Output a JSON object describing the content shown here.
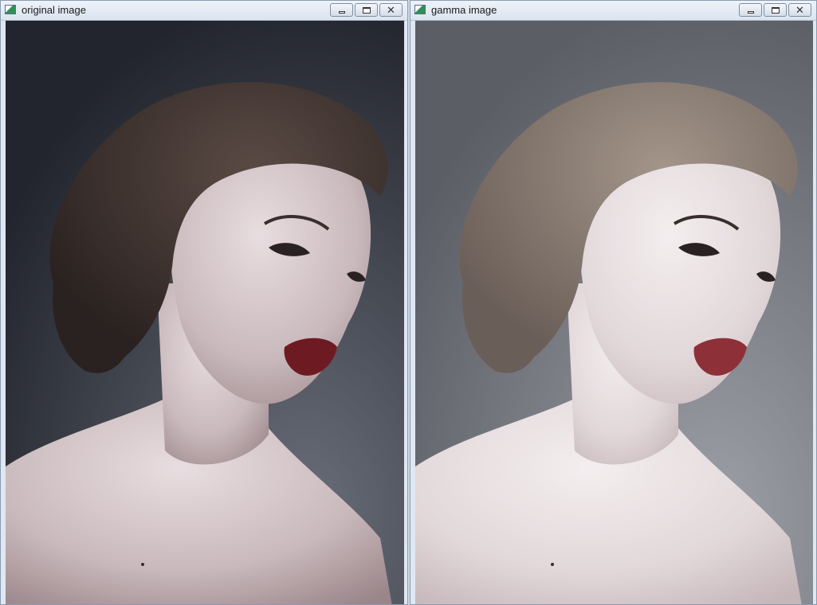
{
  "windows": [
    {
      "title": "original image",
      "controls": {
        "minimize": "minimize",
        "maximize": "maximize",
        "close": "close"
      },
      "icon": "app-window-icon",
      "colors": {
        "bg": "#22252d",
        "bg_light": "#6a6e79",
        "hair": "#2a2220",
        "hair_hi": "#5a4a44",
        "skin": "#c9b9bc",
        "skin_hi": "#e8dde0",
        "skin_shadow": "#9a8589",
        "lips": "#6e1a22"
      }
    },
    {
      "title": "gamma image",
      "controls": {
        "minimize": "minimize",
        "maximize": "maximize",
        "close": "close"
      },
      "icon": "app-window-icon",
      "colors": {
        "bg": "#5c5e66",
        "bg_light": "#9d9fa7",
        "hair": "#6a5e58",
        "hair_hi": "#a39589",
        "skin": "#e2d8da",
        "skin_hi": "#f3eeef",
        "skin_shadow": "#c5b6b8",
        "lips": "#8e3038"
      }
    }
  ]
}
